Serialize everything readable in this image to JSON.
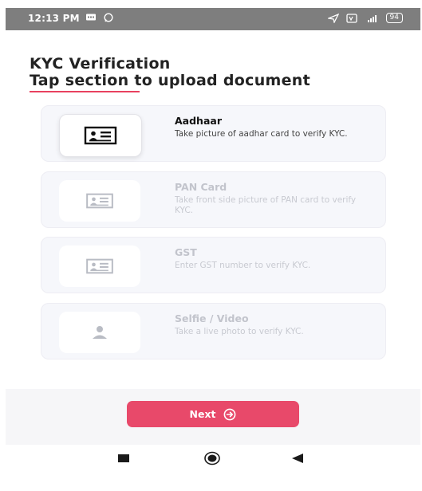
{
  "status_bar": {
    "time": "12:13 PM",
    "battery": "94"
  },
  "header": {
    "title": "KYC Verification",
    "subtitle": "Tap section to upload document"
  },
  "cards": [
    {
      "title": "Aadhaar",
      "description": "Take picture of aadhar card to verify KYC.",
      "icon": "id-card-icon",
      "active": true
    },
    {
      "title": "PAN Card",
      "description": "Take front side picture of PAN card to verify KYC.",
      "icon": "id-card-icon",
      "active": false
    },
    {
      "title": "GST",
      "description": "Enter GST number to verify KYC.",
      "icon": "id-card-icon",
      "active": false
    },
    {
      "title": "Selfie / Video",
      "description": "Take a live photo to verify KYC.",
      "icon": "person-icon",
      "active": false
    }
  ],
  "footer": {
    "next_label": "Next"
  },
  "colors": {
    "accent": "#e8496a",
    "card_bg": "#f6f7fb",
    "status_bar": "#7e7e7e"
  }
}
